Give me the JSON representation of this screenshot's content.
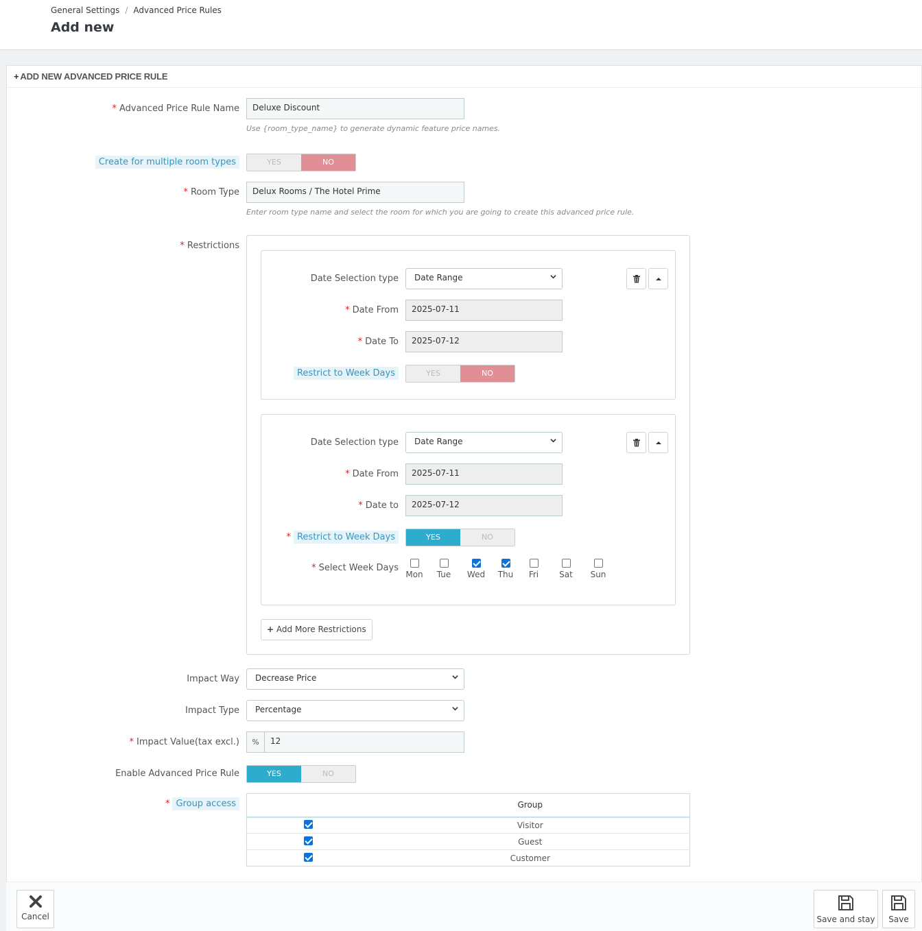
{
  "breadcrumb": {
    "item1": "General Settings",
    "sep": "/",
    "item2": "Advanced Price Rules"
  },
  "page_title": "Add new",
  "panel": {
    "heading": "ADD NEW ADVANCED PRICE RULE",
    "heading_icon": "plus-icon"
  },
  "form": {
    "name": {
      "label": "Advanced Price Rule Name",
      "value": "Deluxe Discount",
      "help": "Use {room_type_name} to generate dynamic feature price names."
    },
    "multiple_room_types": {
      "label": "Create for multiple room types",
      "yes": "YES",
      "no": "NO",
      "selected": "NO"
    },
    "room_type": {
      "label": "Room Type",
      "value": "Delux Rooms / The Hotel Prime",
      "help": "Enter room type name and select the room for which you are going to create this advanced price rule."
    },
    "restrictions_label": "Restrictions",
    "restrictions": [
      {
        "selection_type_label": "Date Selection type",
        "selection_type": "Date Range",
        "date_from_label": "Date From",
        "date_from": "2025-07-11",
        "date_to_label": "Date To",
        "date_to": "2025-07-12",
        "week_days_label": "Restrict to Week Days",
        "yes": "YES",
        "no": "NO",
        "selected": "NO"
      },
      {
        "selection_type_label": "Date Selection type",
        "selection_type": "Date Range",
        "date_from_label": "Date From",
        "date_from": "2025-07-11",
        "date_to_label": "Date to",
        "date_to": "2025-07-12",
        "week_days_label": "Restrict to Week Days",
        "yes": "YES",
        "no": "NO",
        "selected": "YES",
        "select_week_days_label": "Select Week Days",
        "days": [
          {
            "label": "Mon",
            "checked": false
          },
          {
            "label": "Tue",
            "checked": false
          },
          {
            "label": "Wed",
            "checked": true
          },
          {
            "label": "Thu",
            "checked": true
          },
          {
            "label": "Fri",
            "checked": false
          },
          {
            "label": "Sat",
            "checked": false
          },
          {
            "label": "Sun",
            "checked": false
          }
        ]
      }
    ],
    "add_restrictions": "Add More Restrictions",
    "impact_way": {
      "label": "Impact Way",
      "value": "Decrease Price"
    },
    "impact_type": {
      "label": "Impact Type",
      "value": "Percentage"
    },
    "impact_value": {
      "label": "Impact Value(tax excl.)",
      "addon": "%",
      "value": "12"
    },
    "enable": {
      "label": "Enable Advanced Price Rule",
      "yes": "YES",
      "no": "NO",
      "selected": "YES"
    },
    "group_access": {
      "label": "Group access",
      "column": "Group",
      "rows": [
        {
          "name": "Visitor",
          "checked": true
        },
        {
          "name": "Guest",
          "checked": true
        },
        {
          "name": "Customer",
          "checked": true
        }
      ]
    }
  },
  "footer": {
    "cancel": "Cancel",
    "save_and_stay": "Save and stay",
    "save": "Save"
  },
  "colors": {
    "switch_no_active": "#e08f95",
    "switch_yes_active": "#2eacce",
    "required": "#e31b1b",
    "hint_bg": "#e6f4fa",
    "hint_text": "#3894c0"
  }
}
